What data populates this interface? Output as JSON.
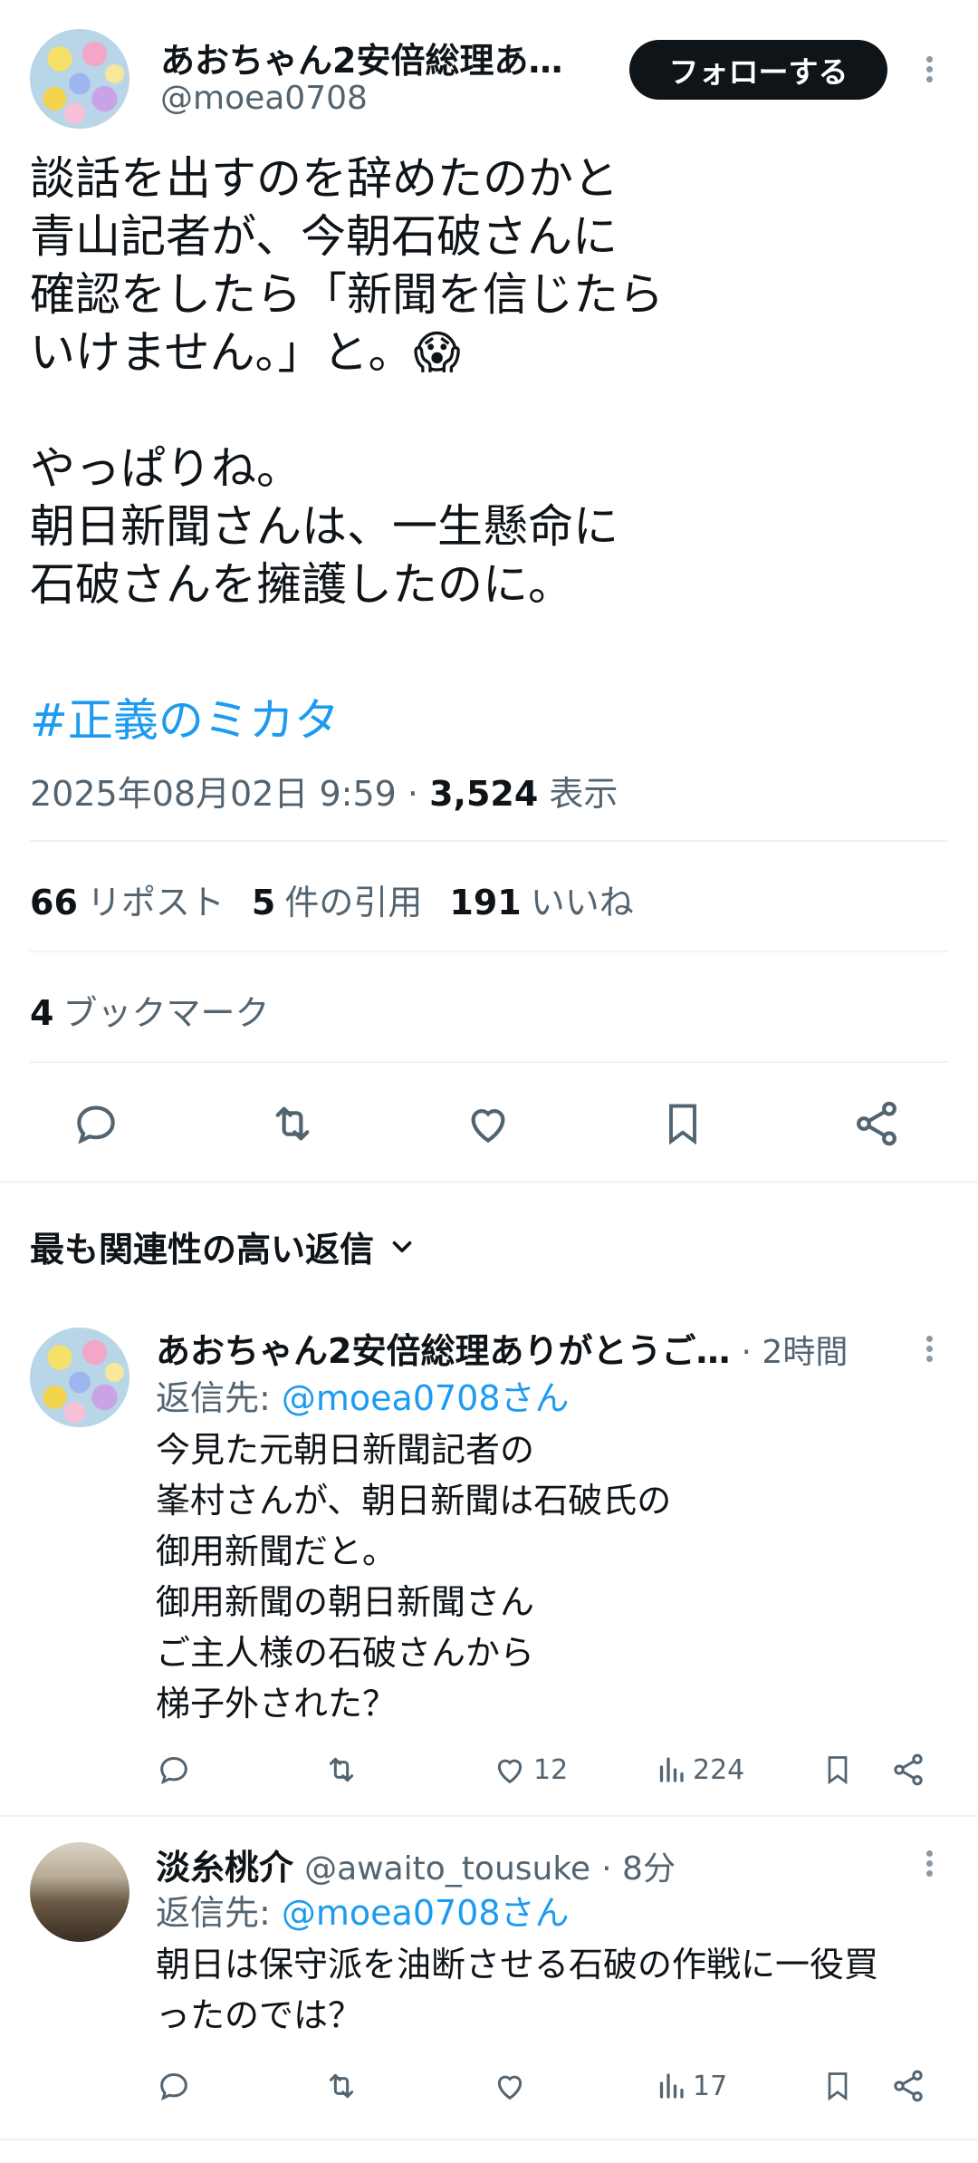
{
  "tweet": {
    "author_name": "あおちゃん2安倍総理あ…",
    "author_handle": "@moea0708",
    "follow_label": "フォローする",
    "lines": [
      "談話を出すのを辞めたのかと",
      "青山記者が、今朝石破さんに",
      "確認をしたら「新聞を信じたら",
      "いけません。」と。😱",
      "",
      "やっぱりね。",
      "朝日新聞さんは、一生懸命に",
      "石破さんを擁護したのに。"
    ],
    "hashtag": "#正義のミカタ",
    "timestamp": "2025年08月02日 9:59",
    "views_count": "3,524",
    "views_label": "表示",
    "reposts_count": "66",
    "reposts_label": "リポスト",
    "quotes_count": "5",
    "quotes_label": "件の引用",
    "likes_count": "191",
    "likes_label": "いいね",
    "bookmarks_count": "4",
    "bookmarks_label": "ブックマーク"
  },
  "sort": {
    "label": "最も関連性の高い返信"
  },
  "replies": [
    {
      "name": "あおちゃん2安倍総理ありがとうご…",
      "time": "· 2時間",
      "reply_to_prefix": "返信先: ",
      "reply_to_handle": "@moea0708さん",
      "lines": [
        "今見た元朝日新聞記者の",
        "峯村さんが、朝日新聞は石破氏の",
        "御用新聞だと。",
        "御用新聞の朝日新聞さん",
        "ご主人様の石破さんから",
        "梯子外された？"
      ],
      "likes": "12",
      "views": "224"
    },
    {
      "name": "淡糸桃介",
      "handle": "@awaito_tousuke",
      "time": "· 8分",
      "reply_to_prefix": "返信先: ",
      "reply_to_handle": "@moea0708さん",
      "lines": [
        "朝日は保守派を油断させる石破の作戦に一役買",
        "ったのでは？"
      ],
      "views": "17"
    }
  ],
  "icons": {
    "reply": "reply-icon",
    "repost": "repost-icon",
    "like": "heart-icon",
    "bookmark": "bookmark-icon",
    "share": "share-icon",
    "views": "views-icon",
    "chevron": "chevron-down-icon",
    "more": "more-icon"
  },
  "colors": {
    "link": "#1d9bf0",
    "text": "#0f1419",
    "secondary": "#536471",
    "follow_bg": "#0f1419"
  }
}
